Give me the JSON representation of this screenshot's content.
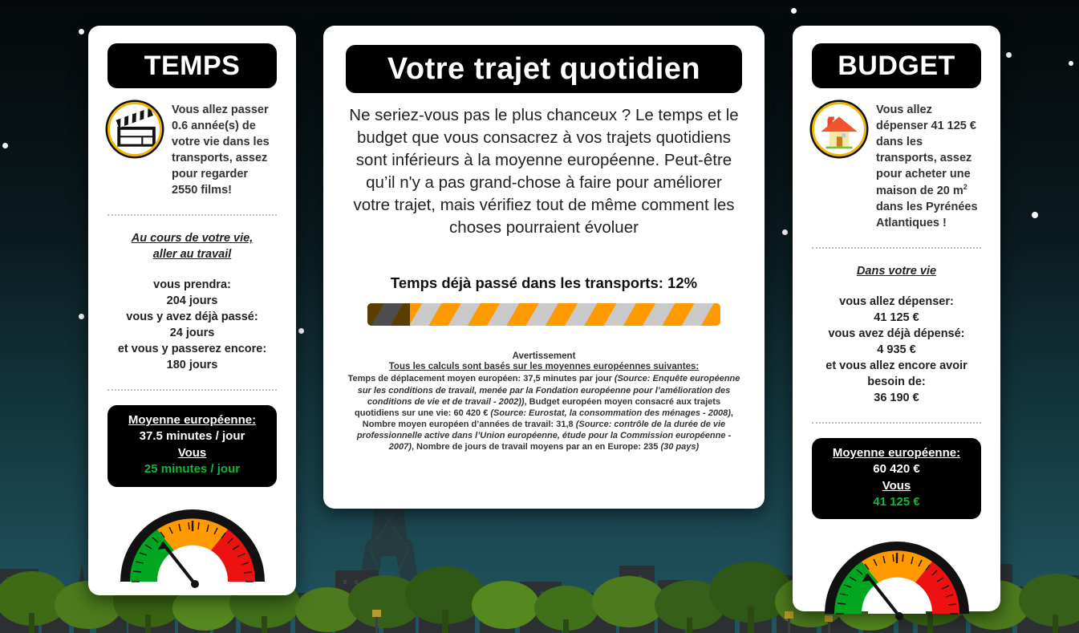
{
  "background": {
    "scene_name": "night-city-skyline-with-eiffel-tower",
    "sky_top": "#05090b",
    "sky_bottom": "#21555f",
    "star_color": "#ffffff"
  },
  "cards": {
    "time": {
      "banner": "TEMPS",
      "icon": "clapperboard-icon",
      "blurb_before": "Vous allez passer 0.6 année(s) de votre vie dans les transports, assez pour regarder 2550 films!",
      "stats_heading_line1": "Au cours de votre vie,",
      "stats_heading_line2": "aller au travail",
      "stat_label_1": "vous prendra:",
      "stat_value_1": "204 jours",
      "stat_label_2": "vous y avez déjà passé:",
      "stat_value_2": "24 jours",
      "stat_label_3": "et vous y passerez encore:",
      "stat_value_3": "180 jours",
      "avg_label": "Moyenne européenne:",
      "avg_value": "37.5 minutes / jour",
      "you_label": "Vous",
      "you_value": "25 minutes / jour",
      "you_color": "#12b832",
      "gauge_needle_pct": 22
    },
    "budget": {
      "banner": "BUDGET",
      "icon": "house-icon",
      "blurb_before": "Vous allez dépenser 41 125 € dans les transports, assez pour acheter une maison de 20 m",
      "blurb_sup": "2",
      "blurb_after": " dans les Pyrénées Atlantiques !",
      "stats_heading_line1": "Dans votre vie",
      "stat_label_1": "vous allez dépenser:",
      "stat_value_1": "41 125 €",
      "stat_label_2": "vous avez déjà dépensé:",
      "stat_value_2": "4 935 €",
      "stat_label_3": "et vous allez encore avoir besoin de:",
      "stat_value_3": "36 190 €",
      "avg_label": "Moyenne européenne:",
      "avg_value": "60 420 €",
      "you_label": "Vous",
      "you_value": "41 125 €",
      "you_color": "#12b832",
      "gauge_needle_pct": 22
    },
    "main": {
      "banner": "Votre trajet quotidien",
      "paragraph": "Ne seriez-vous pas le plus chanceux ? Le temps et le budget que vous consacrez à vos trajets quotidiens sont inférieurs à la moyenne européenne. Peut-être qu’il n'y a pas grand-chose à faire pour améliorer votre trajet, mais vérifiez tout de même comment les choses pourraient évoluer",
      "bar_title": "Temps déjà passé dans les transports: 12%",
      "bar_percent": 12,
      "bar_fill_colors": [
        "#5a3d00",
        "#4d4d4d"
      ],
      "bar_track_colors": [
        "#ff9900",
        "#c9c9c9"
      ],
      "disclaimer_title": "Avertissement",
      "disclaimer_subtitle": "Tous les calculs sont basés sur les moyennes européennes suivantes:",
      "disclaimer_seg_1": "Temps de déplacement moyen européen: 37,5 minutes par jour ",
      "disclaimer_seg_2_italic": "(Source: Enquête européenne sur les conditions de travail, menée par la Fondation européenne pour l’amélioration des conditions de vie et de travail - 2002))",
      "disclaimer_seg_3": ", Budget européen moyen consacré aux trajets quotidiens sur une vie: 60 420 € ",
      "disclaimer_seg_4_italic": "(Source: Eurostat, la consommation des ménages - 2008)",
      "disclaimer_seg_5": ", Nombre moyen européen d’années de travail: 31,8 ",
      "disclaimer_seg_6_italic": "(Source: contrôle de la durée de vie professionnelle active dans l’Union européenne, étude pour la Commission européenne - 2007)",
      "disclaimer_seg_7": ", Nombre de jours de travail moyens par an en Europe: 235 ",
      "disclaimer_seg_8_italic": "(30 pays)"
    }
  },
  "gauge": {
    "green": "#00a61f",
    "orange": "#ff9900",
    "red": "#ee1111",
    "rim": "#111111"
  }
}
